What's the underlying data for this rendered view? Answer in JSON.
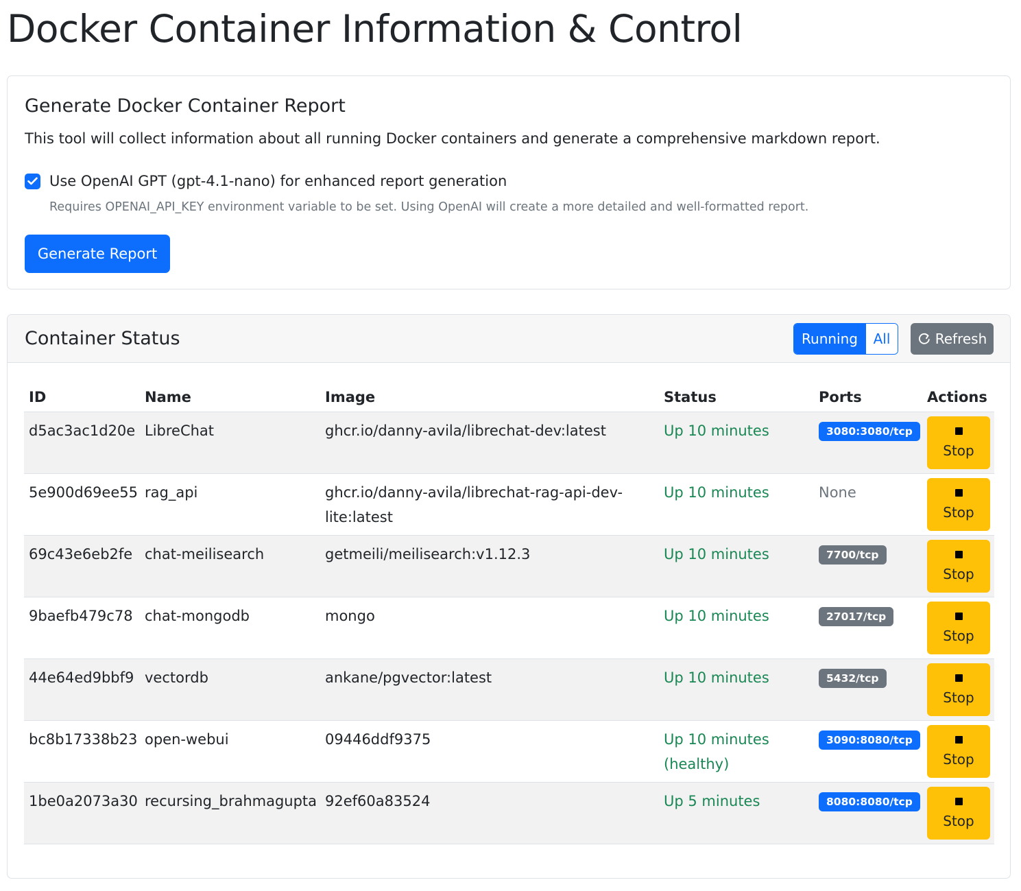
{
  "page": {
    "title": "Docker Container Information & Control"
  },
  "report": {
    "title": "Generate Docker Container Report",
    "description": "This tool will collect information about all running Docker containers and generate a comprehensive markdown report.",
    "openai_label": "Use OpenAI GPT (gpt-4.1-nano) for enhanced report generation",
    "openai_checked": true,
    "help_text": "Requires OPENAI_API_KEY environment variable to be set. Using OpenAI will create a more detailed and well-formatted report.",
    "generate_label": "Generate Report"
  },
  "status": {
    "title": "Container Status",
    "filter_running": "Running",
    "filter_all": "All",
    "active_filter": "Running",
    "refresh_label": "Refresh",
    "columns": {
      "id": "ID",
      "name": "Name",
      "image": "Image",
      "status": "Status",
      "ports": "Ports",
      "actions": "Actions"
    },
    "colors": {
      "primary": "#0d6efd",
      "secondary": "#6c757d",
      "warning": "#ffc107",
      "success": "#198754"
    },
    "rows": [
      {
        "id": "d5ac3ac1d20e",
        "name": "LibreChat",
        "image": [
          "ghcr.io/danny-avila/librechat-dev:latest"
        ],
        "status": [
          "Up 10 minutes"
        ],
        "port": "3080:3080/tcp",
        "port_style": "primary",
        "action": "Stop"
      },
      {
        "id": "5e900d69ee55",
        "name": "rag_api",
        "image": [
          "ghcr.io/danny-avila/librechat-rag-api-dev-",
          "lite:latest"
        ],
        "status": [
          "Up 10 minutes"
        ],
        "port": "None",
        "port_style": "none",
        "action": "Stop"
      },
      {
        "id": "69c43e6eb2fe",
        "name": "chat-meilisearch",
        "image": [
          "getmeili/meilisearch:v1.12.3"
        ],
        "status": [
          "Up 10 minutes"
        ],
        "port": "7700/tcp",
        "port_style": "secondary",
        "action": "Stop"
      },
      {
        "id": "9baefb479c78",
        "name": "chat-mongodb",
        "image": [
          "mongo"
        ],
        "status": [
          "Up 10 minutes"
        ],
        "port": "27017/tcp",
        "port_style": "secondary",
        "action": "Stop"
      },
      {
        "id": "44e64ed9bbf9",
        "name": "vectordb",
        "image": [
          "ankane/pgvector:latest"
        ],
        "status": [
          "Up 10 minutes"
        ],
        "port": "5432/tcp",
        "port_style": "secondary",
        "action": "Stop"
      },
      {
        "id": "bc8b17338b23",
        "name": "open-webui",
        "image": [
          "09446ddf9375"
        ],
        "status": [
          "Up 10 minutes",
          "(healthy)"
        ],
        "port": "3090:8080/tcp",
        "port_style": "primary",
        "action": "Stop"
      },
      {
        "id": "1be0a2073a30",
        "name": "recursing_brahmagupta",
        "image": [
          "92ef60a83524"
        ],
        "status": [
          "Up 5 minutes"
        ],
        "port": "8080:8080/tcp",
        "port_style": "primary",
        "action": "Stop"
      }
    ]
  }
}
